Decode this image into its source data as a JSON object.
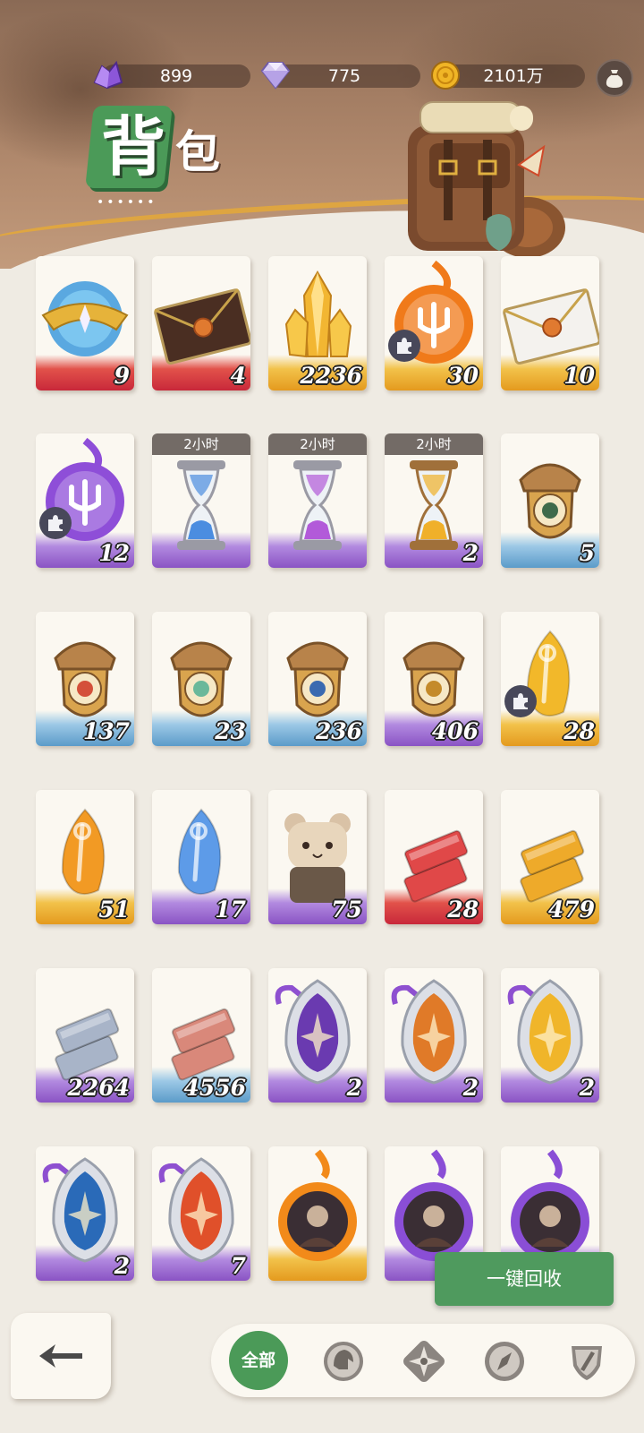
{
  "header": {
    "title_char_1": "背",
    "title_char_2": "包",
    "title_dots": "••••••"
  },
  "currencies": [
    {
      "name": "purple-crystal",
      "value": "899"
    },
    {
      "name": "diamond",
      "value": "775"
    },
    {
      "name": "gold-coin",
      "value": "2101万"
    }
  ],
  "items": [
    {
      "icon": "celestial-orb-crown",
      "qty": "9",
      "band": "red"
    },
    {
      "icon": "sealed-letter-dark",
      "qty": "4",
      "band": "red"
    },
    {
      "icon": "gold-crystal",
      "qty": "2236",
      "band": "gold"
    },
    {
      "icon": "fire-trident-orb",
      "qty": "30",
      "band": "gold",
      "puzzle": true
    },
    {
      "icon": "sealed-letter-white",
      "qty": "10",
      "band": "gold"
    },
    {
      "icon": "purple-trident-orb",
      "qty": "12",
      "band": "purple",
      "puzzle": true
    },
    {
      "icon": "hourglass-blue",
      "qty": "",
      "band": "purple",
      "timer": "2小时"
    },
    {
      "icon": "hourglass-purple",
      "qty": "",
      "band": "purple",
      "timer": "2小时"
    },
    {
      "icon": "hourglass-gold",
      "qty": "2",
      "band": "purple",
      "timer": "2小时"
    },
    {
      "icon": "acorn-badge-eye",
      "qty": "5",
      "band": "blue"
    },
    {
      "icon": "acorn-badge-sun",
      "qty": "137",
      "band": "blue"
    },
    {
      "icon": "acorn-badge-leaf",
      "qty": "23",
      "band": "blue"
    },
    {
      "icon": "acorn-badge-star",
      "qty": "236",
      "band": "blue"
    },
    {
      "icon": "acorn-badge-diamond",
      "qty": "406",
      "band": "purple"
    },
    {
      "icon": "golden-leaf-gem",
      "qty": "28",
      "band": "gold",
      "puzzle": true
    },
    {
      "icon": "orange-leaf-gem",
      "qty": "51",
      "band": "gold"
    },
    {
      "icon": "blue-leaf-gem",
      "qty": "17",
      "band": "purple"
    },
    {
      "icon": "hamster-knight",
      "qty": "75",
      "band": "purple"
    },
    {
      "icon": "red-ingots",
      "qty": "28",
      "band": "red"
    },
    {
      "icon": "gold-ingots",
      "qty": "479",
      "band": "gold"
    },
    {
      "icon": "silver-ingots",
      "qty": "2264",
      "band": "purple"
    },
    {
      "icon": "copper-ingots",
      "qty": "4556",
      "band": "blue"
    },
    {
      "icon": "purple-rune-shield",
      "qty": "2",
      "band": "purple"
    },
    {
      "icon": "fire-burst-shield",
      "qty": "2",
      "band": "purple"
    },
    {
      "icon": "golden-star-shield",
      "qty": "2",
      "band": "purple"
    },
    {
      "icon": "vortex-shield",
      "qty": "2",
      "band": "purple"
    },
    {
      "icon": "flame-shield",
      "qty": "7",
      "band": "purple"
    },
    {
      "icon": "fire-portrait-orb",
      "qty": "",
      "band": "gold"
    },
    {
      "icon": "purple-portrait-orb-forest",
      "qty": "",
      "band": "purple"
    },
    {
      "icon": "purple-portrait-orb-hero",
      "qty": "",
      "band": "purple"
    }
  ],
  "actions": {
    "recycle_label": "一键回收",
    "filter_all_label": "全部"
  },
  "filters": [
    "helmet-filter-icon",
    "compass-star-filter-icon",
    "compass-filter-icon",
    "shield-sword-filter-icon"
  ]
}
